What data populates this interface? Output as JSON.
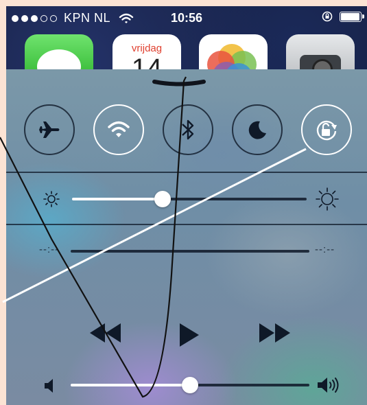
{
  "status_bar": {
    "carrier": "KPN NL",
    "time": "10:56",
    "signal_bars_filled": 3,
    "signal_bars_total": 5,
    "battery_level": 0.9
  },
  "home_apps": [
    {
      "name": "messages",
      "icon": "messages-icon"
    },
    {
      "name": "calendar",
      "icon": "calendar-icon",
      "weekday": "vrijdag",
      "day": "14"
    },
    {
      "name": "photos",
      "icon": "photos-icon"
    },
    {
      "name": "camera",
      "icon": "camera-icon"
    }
  ],
  "control_center": {
    "toggles": [
      {
        "id": "airplane-mode",
        "icon": "airplane-icon",
        "on": false
      },
      {
        "id": "wifi",
        "icon": "wifi-icon",
        "on": true
      },
      {
        "id": "bluetooth",
        "icon": "bluetooth-icon",
        "on": false
      },
      {
        "id": "do-not-disturb",
        "icon": "moon-icon",
        "on": false
      },
      {
        "id": "rotation-lock",
        "icon": "rotation-lock-icon",
        "on": true
      }
    ],
    "brightness_level": 0.4,
    "music": {
      "elapsed": "--:--",
      "remaining": "--:--",
      "controls": [
        "rewind-icon",
        "play-icon",
        "fast-forward-icon"
      ]
    },
    "volume_level": 0.5
  },
  "colors": {
    "background": "#fbe3d4",
    "toggle_on": "#ffffff",
    "toggle_off": "#0f1928",
    "calendar_weekday": "#e0402f"
  }
}
